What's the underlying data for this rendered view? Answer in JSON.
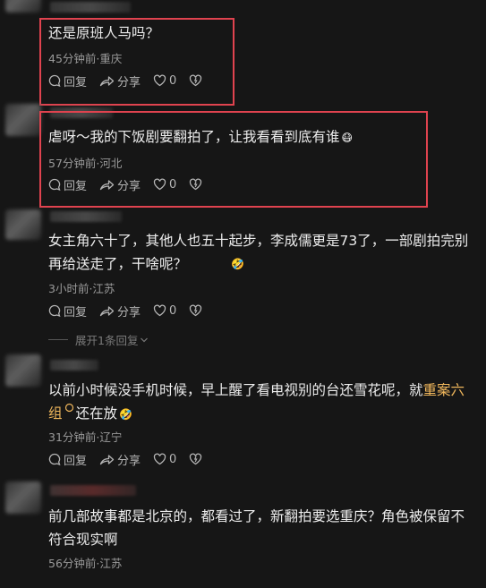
{
  "comments": [
    {
      "text": "还是原班人马吗？",
      "meta": "45分钟前·重庆",
      "reply_label": "回复",
      "share_label": "分享",
      "like_count": "0"
    },
    {
      "text": "虐呀～我的下饭剧要翻拍了，让我看看到底有谁",
      "meta": "57分钟前·河北",
      "reply_label": "回复",
      "share_label": "分享",
      "like_count": "0"
    },
    {
      "text": "女主角六十了，其他人也五十起步，李成儒更是73了，一部剧拍完别再给送走了，干啥呢？",
      "meta": "3小时前·江苏",
      "reply_label": "回复",
      "share_label": "分享",
      "like_count": "0",
      "expand_label": "展开1条回复"
    },
    {
      "text_before": "以前小时候没手机时候，早上醒了看电视别的台还雪花呢，就",
      "text_link": "重案六组",
      "text_after": "还在放",
      "meta": "31分钟前·辽宁",
      "reply_label": "回复",
      "share_label": "分享",
      "like_count": "0"
    },
    {
      "text": "前几部故事都是北京的，都看过了，新翻拍要选重庆？角色被保留不符合现实啊",
      "meta": "56分钟前·江苏"
    }
  ],
  "colors": {
    "background": "#161616",
    "highlight_box": "#e0434f",
    "link": "#f0b75c"
  },
  "icons": [
    "comment-bubble-icon",
    "share-arrow-icon",
    "heart-icon",
    "dislike-heart-icon",
    "emoji-icon",
    "search-circle-icon",
    "chevron-down-icon"
  ]
}
